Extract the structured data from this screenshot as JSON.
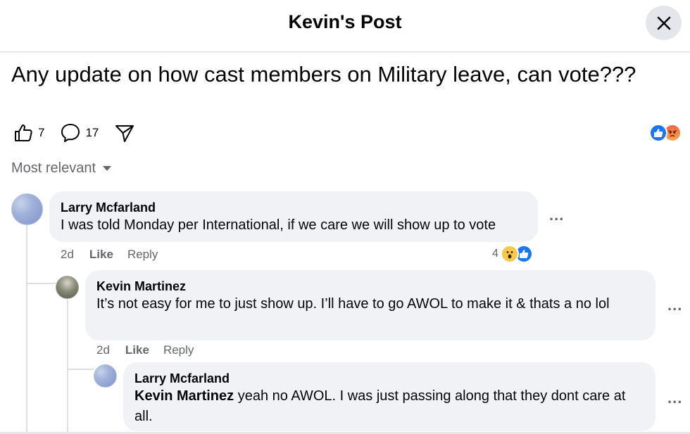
{
  "header": {
    "title": "Kevin's Post"
  },
  "post": {
    "text": "Any update on how cast members on Military leave, can vote???",
    "like_count": "7",
    "comment_count": "17",
    "icons": {
      "like": "thumbs-up-icon",
      "comment": "comment-icon",
      "share": "share-icon"
    },
    "reaction_summary": [
      "like",
      "angry"
    ]
  },
  "sort": {
    "label": "Most relevant"
  },
  "comments": [
    {
      "author": "Larry Mcfarland",
      "text": "I was told Monday per International, if we care we will show up to vote",
      "time": "2d",
      "like_label": "Like",
      "reply_label": "Reply",
      "reaction_count": "4",
      "reactions": [
        "wow",
        "like"
      ]
    },
    {
      "author": "Kevin Martinez",
      "text": "It’s not easy for me to just show up. I’ll have to go AWOL to make it & thats a no lol",
      "time": "2d",
      "like_label": "Like",
      "reply_label": "Reply"
    },
    {
      "author": "Larry Mcfarland",
      "mention": "Kevin Martinez",
      "text": " yeah no AWOL. I was just passing along that they dont care at all."
    }
  ],
  "more_label": "...",
  "colors": {
    "accent": "#1877f2",
    "bubble": "#f0f2f5",
    "muted": "#65676b"
  }
}
